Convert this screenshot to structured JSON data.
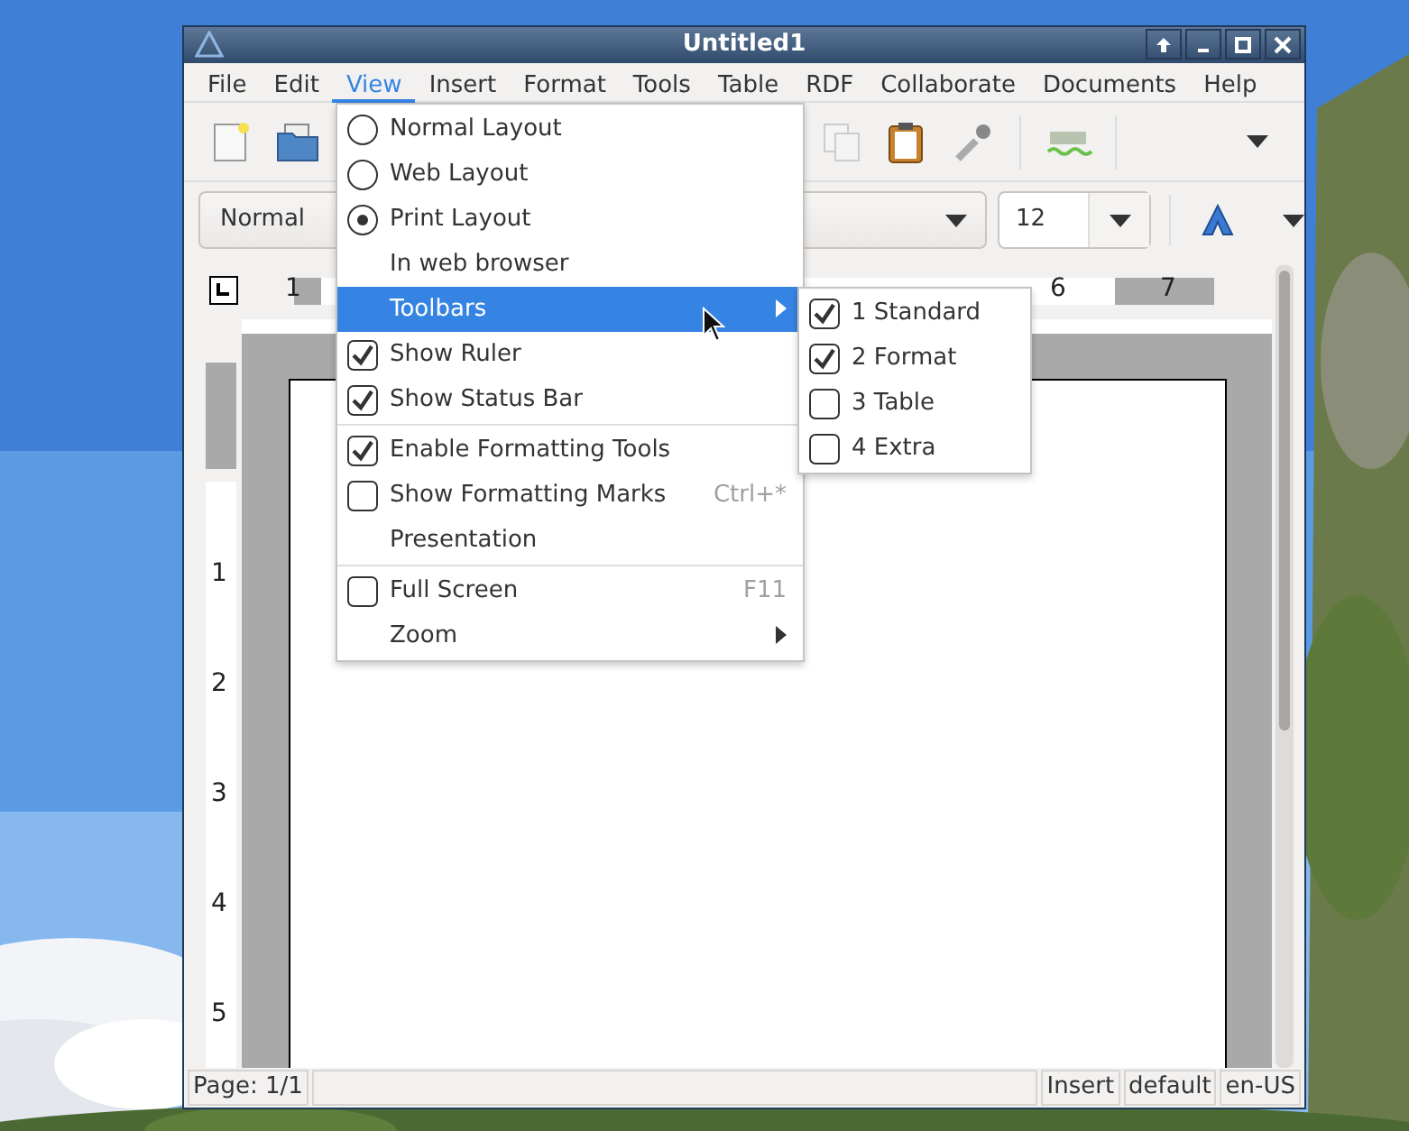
{
  "window": {
    "title": "Untitled1"
  },
  "menubar": [
    {
      "label": "File",
      "selected": false
    },
    {
      "label": "Edit",
      "selected": false
    },
    {
      "label": "View",
      "selected": true
    },
    {
      "label": "Insert",
      "selected": false
    },
    {
      "label": "Format",
      "selected": false
    },
    {
      "label": "Tools",
      "selected": false
    },
    {
      "label": "Table",
      "selected": false
    },
    {
      "label": "RDF",
      "selected": false
    },
    {
      "label": "Collaborate",
      "selected": false
    },
    {
      "label": "Documents",
      "selected": false
    },
    {
      "label": "Help",
      "selected": false
    }
  ],
  "format_toolbar": {
    "style": "Normal",
    "size": "12"
  },
  "h_ruler": [
    "1",
    "6",
    "7"
  ],
  "v_ruler": [
    "1",
    "2",
    "3",
    "4",
    "5"
  ],
  "view_menu": [
    [
      {
        "kind": "radio",
        "label": "Normal Layout",
        "checked": false
      },
      {
        "kind": "radio",
        "label": "Web Layout",
        "checked": false
      },
      {
        "kind": "radio",
        "label": "Print Layout",
        "checked": true
      },
      {
        "kind": "plain",
        "label": "In web browser"
      },
      {
        "kind": "submenu",
        "label": "Toolbars",
        "selected": true
      },
      {
        "kind": "check",
        "label": "Show Ruler",
        "checked": true
      },
      {
        "kind": "check",
        "label": "Show Status Bar",
        "checked": true
      }
    ],
    [
      {
        "kind": "check",
        "label": "Enable Formatting Tools",
        "checked": true
      },
      {
        "kind": "check",
        "label": "Show Formatting Marks",
        "checked": false,
        "shortcut": "Ctrl+*"
      },
      {
        "kind": "plain",
        "label": "Presentation"
      }
    ],
    [
      {
        "kind": "check",
        "label": "Full Screen",
        "checked": false,
        "shortcut": "F11"
      },
      {
        "kind": "submenu",
        "label": "Zoom",
        "selected": false
      }
    ]
  ],
  "toolbars_submenu": [
    {
      "label": "1 Standard",
      "checked": true
    },
    {
      "label": "2 Format",
      "checked": true
    },
    {
      "label": "3 Table",
      "checked": false
    },
    {
      "label": "4 Extra",
      "checked": false
    }
  ],
  "status_bar": {
    "page": "Page: 1/1",
    "mode": "Insert",
    "style": "default",
    "language": "en-US"
  }
}
